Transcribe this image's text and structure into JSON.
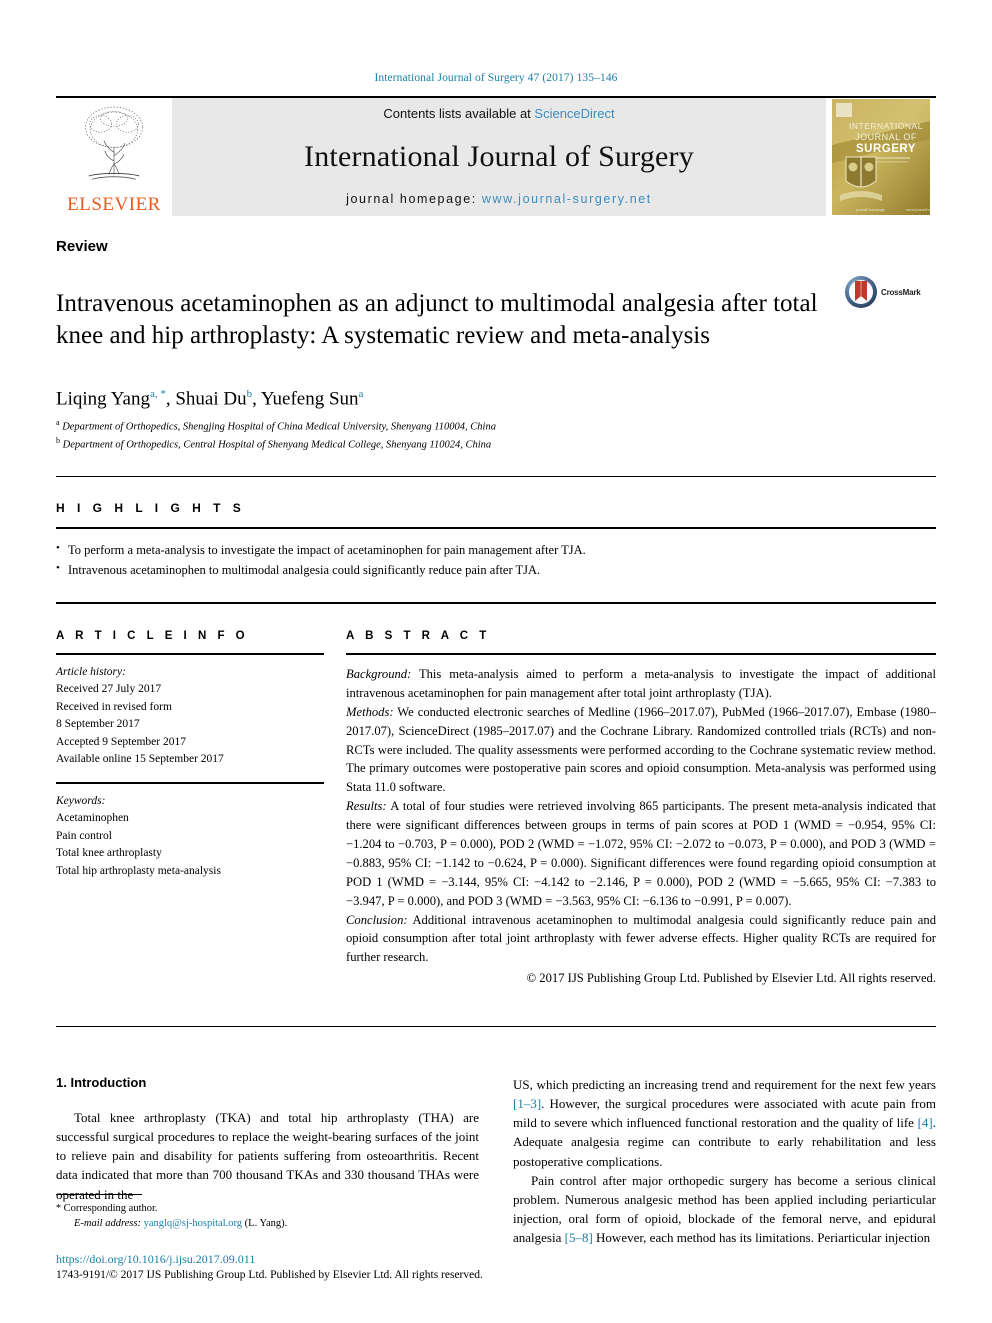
{
  "running_head": "International Journal of Surgery 47 (2017) 135–146",
  "masthead": {
    "publisher_name": "ELSEVIER",
    "contents_prefix": "Contents lists available at ",
    "contents_link": "ScienceDirect",
    "journal_name": "International Journal of Surgery",
    "homepage_prefix": "journal homepage: ",
    "homepage_url": "www.journal-surgery.net",
    "cover_title_line1": "INTERNATIONAL",
    "cover_title_line2": "JOURNAL OF",
    "cover_title_line3": "SURGERY"
  },
  "article": {
    "type": "Review",
    "title": "Intravenous acetaminophen as an adjunct to multimodal analgesia after total knee and hip arthroplasty: A systematic review and meta-analysis",
    "crossmark_label": "CrossMark",
    "authors": [
      {
        "name": "Liqing Yang",
        "marks": "a, *"
      },
      {
        "name": "Shuai Du",
        "marks": "b"
      },
      {
        "name": "Yuefeng Sun",
        "marks": "a"
      }
    ],
    "affiliations": [
      {
        "mark": "a",
        "text": "Department of Orthopedics, Shengjing Hospital of China Medical University, Shenyang 110004, China"
      },
      {
        "mark": "b",
        "text": "Department of Orthopedics, Central Hospital of Shenyang Medical College, Shenyang 110024, China"
      }
    ]
  },
  "highlights": {
    "heading": "H I G H L I G H T S",
    "items": [
      "To perform a meta-analysis to investigate the impact of acetaminophen for pain management after TJA.",
      "Intravenous acetaminophen to multimodal analgesia could significantly reduce pain after TJA."
    ]
  },
  "article_info": {
    "heading": "A R T I C L E   I N F O",
    "history_label": "Article history:",
    "history": [
      "Received 27 July 2017",
      "Received in revised form",
      "8 September 2017",
      "Accepted 9 September 2017",
      "Available online 15 September 2017"
    ],
    "keywords_label": "Keywords:",
    "keywords": [
      "Acetaminophen",
      "Pain control",
      "Total knee arthroplasty",
      "Total hip arthroplasty meta-analysis"
    ]
  },
  "abstract": {
    "heading": "A B S T R A C T",
    "background_label": "Background:",
    "background_text": " This meta-analysis aimed to perform a meta-analysis to investigate the impact of additional intravenous acetaminophen for pain management after total joint arthroplasty (TJA).",
    "methods_label": "Methods:",
    "methods_text": " We conducted electronic searches of Medline (1966–2017.07), PubMed (1966–2017.07), Embase (1980–2017.07), ScienceDirect (1985–2017.07) and the Cochrane Library. Randomized controlled trials (RCTs) and non-RCTs were included. The quality assessments were performed according to the Cochrane systematic review method. The primary outcomes were postoperative pain scores and opioid consumption. Meta-analysis was performed using Stata 11.0 software.",
    "results_label": "Results:",
    "results_text": " A total of four studies were retrieved involving 865 participants. The present meta-analysis indicated that there were significant differences between groups in terms of pain scores at POD 1 (WMD = −0.954, 95% CI: −1.204 to −0.703, P = 0.000), POD 2 (WMD = −1.072, 95% CI: −2.072 to −0.073, P = 0.000), and POD 3 (WMD = −0.883, 95% CI: −1.142 to −0.624, P = 0.000). Significant differences were found regarding opioid consumption at POD 1 (WMD = −3.144, 95% CI: −4.142 to −2.146, P = 0.000), POD 2 (WMD = −5.665, 95% CI: −7.383 to −3.947, P = 0.000), and POD 3 (WMD = −3.563, 95% CI: −6.136 to −0.991, P = 0.007).",
    "conclusion_label": "Conclusion:",
    "conclusion_text": " Additional intravenous acetaminophen to multimodal analgesia could significantly reduce pain and opioid consumption after total joint arthroplasty with fewer adverse effects. Higher quality RCTs are required for further research.",
    "copyright": "© 2017 IJS Publishing Group Ltd. Published by Elsevier Ltd. All rights reserved."
  },
  "body": {
    "section_number_title": "1. Introduction",
    "left_paragraph_1": "Total knee arthroplasty (TKA) and total hip arthroplasty (THA) are successful surgical procedures to replace the weight-bearing surfaces of the joint to relieve pain and disability for patients suffering from osteoarthritis. Recent data indicated that more than 700 thousand TKAs and 330 thousand THAs were operated in the",
    "right_p1_a": "US, which predicting an increasing trend and requirement for the next few years ",
    "right_p1_ref1": "[1–3]",
    "right_p1_b": ". However, the surgical procedures were associated with acute pain from mild to severe which influenced functional restoration and the quality of life ",
    "right_p1_ref2": "[4]",
    "right_p1_c": ". Adequate analgesia regime can contribute to early rehabilitation and less postoperative complications.",
    "right_p2_a": "Pain control after major orthopedic surgery has become a serious clinical problem. Numerous analgesic method has been applied including periarticular injection, oral form of opioid, blockade of the femoral nerve, and epidural analgesia ",
    "right_p2_ref1": "[5–8]",
    "right_p2_b": " However, each method has its limitations. Periarticular injection"
  },
  "footer": {
    "corresponding_author": "Corresponding author.",
    "email_label": "E-mail address:",
    "email": "yanglq@sj-hospital.org",
    "email_owner": "(L. Yang).",
    "doi": "https://doi.org/10.1016/j.ijsu.2017.09.011",
    "issn_copyright": "1743-9191/© 2017 IJS Publishing Group Ltd. Published by Elsevier Ltd. All rights reserved."
  },
  "colors": {
    "link_blue": "#1a7fa8",
    "elsevier_orange": "#E85C20",
    "band_gray": "#e8e8e8"
  }
}
